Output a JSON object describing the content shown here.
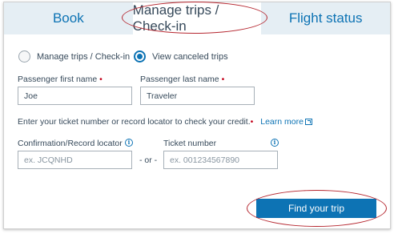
{
  "tabs": [
    {
      "label": "Book",
      "active": false
    },
    {
      "label": "Manage trips / Check-in",
      "active": true
    },
    {
      "label": "Flight status",
      "active": false
    }
  ],
  "radios": {
    "manage_label": "Manage trips / Check-in",
    "canceled_label": "View canceled trips",
    "selected": "View canceled trips"
  },
  "form": {
    "first_name_label": "Passenger first name",
    "first_name_value": "Joe",
    "last_name_label": "Passenger last name",
    "last_name_value": "Traveler",
    "required_mark": "•",
    "instructions": "Enter your ticket number or record locator to check your credit.",
    "learn_more": "Learn more",
    "confirmation_label": "Confirmation/Record locator",
    "confirmation_placeholder": "ex. JCQNHD",
    "or_text": "- or -",
    "ticket_label": "Ticket number",
    "ticket_placeholder": "ex. 001234567890",
    "info_glyph": "i"
  },
  "actions": {
    "find_label": "Find your trip"
  },
  "colors": {
    "accent": "#0d73b4",
    "tab_bg": "#e5eef4",
    "required": "#c30019",
    "highlight_circle": "#b5262f"
  }
}
